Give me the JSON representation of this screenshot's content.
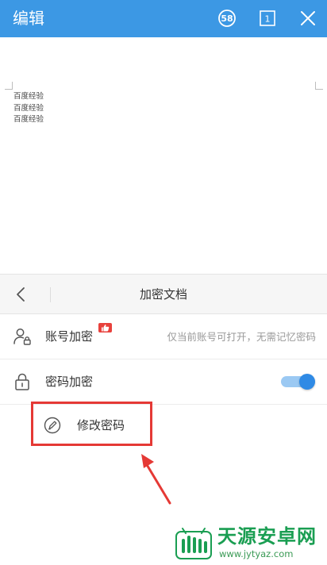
{
  "topbar": {
    "title": "编辑",
    "count_badge": "58",
    "page_indicator": "1",
    "bg_color": "#3c98e4"
  },
  "document": {
    "lines": [
      "百度经验",
      "百度经验",
      "百度经验"
    ]
  },
  "panel": {
    "title": "加密文档",
    "account_row": {
      "label": "账号加密",
      "hint": "仅当前账号可打开，无需记忆密码",
      "badge_icon": "thumbs-up-icon"
    },
    "password_row": {
      "label": "密码加密",
      "toggle_on": true
    },
    "change_row": {
      "label": "修改密码"
    }
  },
  "watermark": {
    "name": "天源安卓网",
    "url": "www.jytyaz.com"
  },
  "colors": {
    "accent": "#2f8ae5",
    "highlight": "#e53935",
    "watermark": "#1a9e52"
  }
}
